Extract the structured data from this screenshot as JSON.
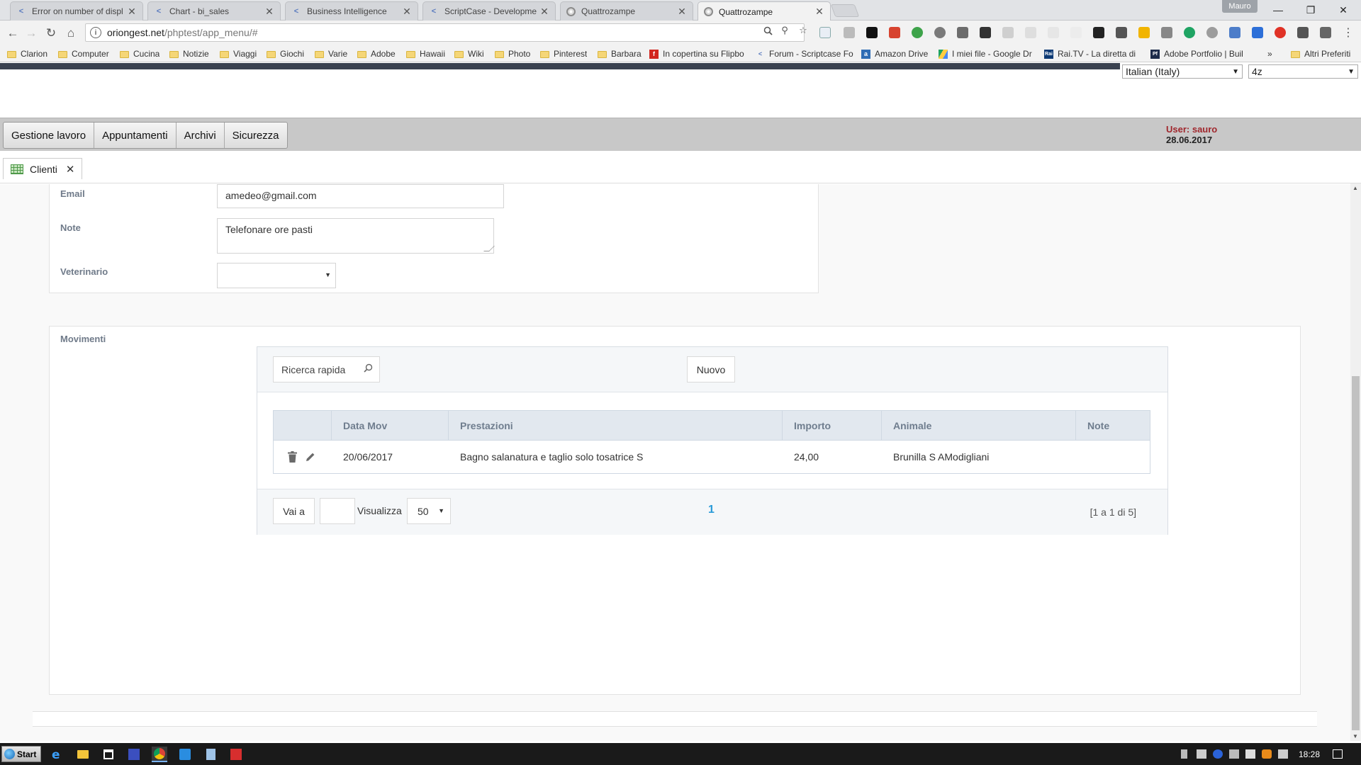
{
  "browser": {
    "tabs": [
      {
        "label": "Error on number of displ",
        "icon": "scriptcase-icon"
      },
      {
        "label": "Chart - bi_sales",
        "icon": "scriptcase-icon"
      },
      {
        "label": "Business Intelligence",
        "icon": "scriptcase-icon"
      },
      {
        "label": "ScriptCase - Developmen",
        "icon": "scriptcase-icon"
      },
      {
        "label": "Quattrozampe",
        "icon": "globe-icon"
      },
      {
        "label": "Quattrozampe",
        "icon": "globe-icon",
        "active": true
      }
    ],
    "profile_name": "Mauro",
    "url_host": "oriongest.net",
    "url_path": "/phptest/app_menu/#",
    "bookmarks": [
      "Clarion",
      "Computer",
      "Cucina",
      "Notizie",
      "Viaggi",
      "Giochi",
      "Varie",
      "Adobe",
      "Hawaii",
      "Wiki",
      "Photo",
      "Pinterest",
      "Barbara",
      "In copertina su Flipbo",
      "Forum - Scriptcase Fo",
      "Amazon Drive",
      "I miei file - Google Dr",
      "Rai.TV - La diretta di R",
      "Adobe Portfolio | Buil"
    ],
    "bookmarks_overflow": "»",
    "other_bookmarks": "Altri Preferiti"
  },
  "header": {
    "language": "Italian (Italy)",
    "theme": "4z",
    "menu": [
      "Gestione lavoro",
      "Appuntamenti",
      "Archivi",
      "Sicurezza"
    ],
    "user_label": "User: sauro",
    "date": "28.06.2017"
  },
  "app_tab": {
    "label": "Clienti"
  },
  "form": {
    "email_label": "Email",
    "email_value": "amedeo@gmail.com",
    "note_label": "Note",
    "note_value": "Telefonare ore pasti",
    "vet_label": "Veterinario",
    "vet_value": ""
  },
  "movimenti": {
    "title": "Movimenti",
    "search_placeholder": "Ricerca rapida",
    "new_button": "Nuovo",
    "columns": [
      "Data Mov",
      "Prestazioni",
      "Importo",
      "Animale",
      "Note"
    ],
    "rows": [
      {
        "data_mov": "20/06/2017",
        "prestazioni": "Bagno salanatura e taglio solo tosatrice S",
        "importo": "24,00",
        "animale": "Brunilla S AModigliani",
        "note": ""
      }
    ],
    "goto_button": "Vai a",
    "goto_value": "",
    "visualizza_label": "Visualizza",
    "per_page": "50",
    "current_page": "1",
    "page_info": "[1 a 1 di 5]"
  },
  "taskbar": {
    "start_label": "Start",
    "clock": "18:28"
  }
}
